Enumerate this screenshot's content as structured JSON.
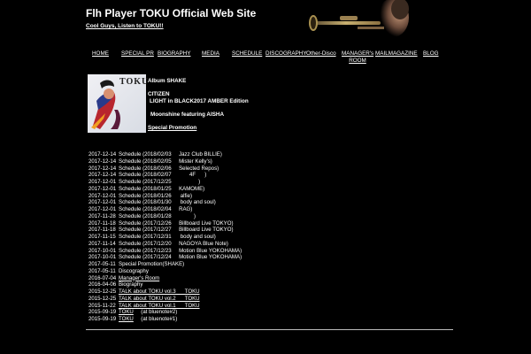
{
  "site": {
    "title": "Flh Player TOKU Official Web Site",
    "tagline": "Cool Guys, Listen to TOKU!!"
  },
  "nav": [
    {
      "label": "HOME",
      "name": "nav-home"
    },
    {
      "label": "SPECIAL PR",
      "name": "nav-special-pr"
    },
    {
      "label": "BIOGRAPHY",
      "name": "nav-biography"
    },
    {
      "label": "MEDIA",
      "name": "nav-media"
    },
    {
      "label": "SCHEDULE",
      "name": "nav-schedule"
    },
    {
      "label": "DISCOGRAPHY",
      "name": "nav-discography"
    },
    {
      "label": "Other-Disco",
      "name": "nav-other-disco"
    },
    {
      "label": "MANAGER's ROOM",
      "name": "nav-managers-room"
    },
    {
      "label": "MAILMAGAZINE",
      "name": "nav-mailmagazine"
    },
    {
      "label": "BLOG",
      "name": "nav-blog"
    }
  ],
  "album": {
    "cover_text": "TOKU",
    "title": "Album  SHAKE",
    "track_1": "CITIZEN",
    "track_2": "LIGHT in BLACK2017 AMBER Edition",
    "track_3": "Moonshine featuring AISHA",
    "promo_link": "Special Promotion"
  },
  "news": [
    {
      "date": "2017-12-14",
      "text": "Schedule (2018/02/03     Jazz Club BILLIE)"
    },
    {
      "date": "2017-12-14",
      "text": "Schedule (2018/02/05     Mister Kelly's)"
    },
    {
      "date": "2017-12-14",
      "text": "Schedule (2018/02/06     Selected Repos)"
    },
    {
      "date": "2017-12-14",
      "text": "Schedule (2018/02/07            4F      )"
    },
    {
      "date": "2017-12-01",
      "text": "Schedule (2017/12/25                  )"
    },
    {
      "date": "2017-12-01",
      "text": "Schedule (2018/01/25     KAMOME)"
    },
    {
      "date": "2017-12-01",
      "text": "Schedule (2018/01/26      alfie)"
    },
    {
      "date": "2017-12-01",
      "text": "Schedule (2018/01/30      body and soul)"
    },
    {
      "date": "2017-12-01",
      "text": "Schedule (2018/02/04     RAG)"
    },
    {
      "date": "2017-11-28",
      "text": "Schedule (2018/01/28               )"
    },
    {
      "date": "2017-11-18",
      "text": "Schedule (2017/12/26     Billboard Live TOKYO)"
    },
    {
      "date": "2017-11-18",
      "text": "Schedule (2017/12/27     Billboard Live TOKYO)"
    },
    {
      "date": "2017-11-15",
      "text": "Schedule (2017/12/31      body and soul)"
    },
    {
      "date": "2017-11-14",
      "text": "Schedule (2017/12/20     NAGOYA Blue Note)"
    },
    {
      "date": "2017-10-01",
      "text": "Schedule (2017/12/23     Motion Blue YOKOHAMA)"
    },
    {
      "date": "2017-10-01",
      "text": "Schedule (2017/12/24     Motion Blue YOKOHAMA)"
    },
    {
      "date": "2017-05-11",
      "text": "Special Promotion(SHAKE)"
    },
    {
      "date": "2017-05-11",
      "text": "Discography"
    },
    {
      "date": "2016-07-04",
      "text": "",
      "link": "Manager's Room",
      "suffix": ""
    },
    {
      "date": "2016-04-06",
      "text": "Biography"
    },
    {
      "date": "2015-12-25",
      "text": "",
      "link": "TALK about TOKU vol.3      TOKU",
      "suffix": ""
    },
    {
      "date": "2015-12-25",
      "text": "",
      "link": "TALK about TOKU vol.2      TOKU",
      "suffix": ""
    },
    {
      "date": "2015-11-22",
      "text": "",
      "link": "TALK about TOKU vol.1      TOKU",
      "suffix": ""
    },
    {
      "date": "2015-09-19",
      "text": "",
      "link": "TOKU",
      "suffix": "     (at bluenote#2)"
    },
    {
      "date": "2015-09-19",
      "text": "",
      "link": "TOKU",
      "suffix": "     (at bluenote#1)"
    }
  ],
  "colors": {
    "background": "#000000",
    "text": "#ffffff"
  },
  "icons": {
    "header_photo": "trumpet-player-photo",
    "album_cover": "album-cover-art"
  }
}
